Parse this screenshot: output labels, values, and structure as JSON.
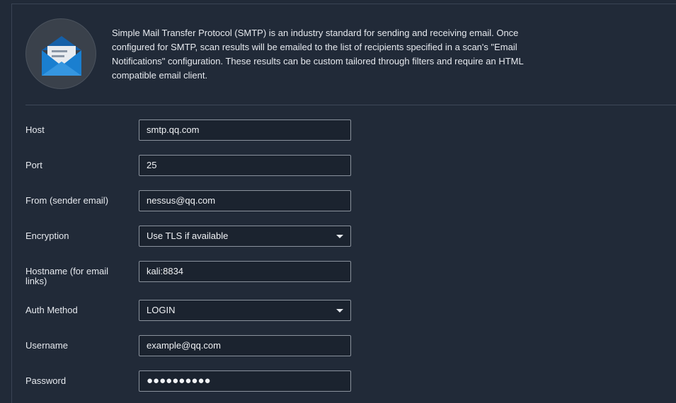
{
  "intro": {
    "icon": "email-envelope-icon",
    "description": "Simple Mail Transfer Protocol (SMTP) is an industry standard for sending and receiving email. Once configured for SMTP, scan results will be emailed to the list of recipients specified in a scan's \"Email Notifications\" configuration. These results can be custom tailored through filters and require an HTML compatible email client."
  },
  "form": {
    "host": {
      "label": "Host",
      "value": "smtp.qq.com"
    },
    "port": {
      "label": "Port",
      "value": "25"
    },
    "from": {
      "label": "From (sender email)",
      "value": "nessus@qq.com"
    },
    "encryption": {
      "label": "Encryption",
      "value": "Use TLS if available"
    },
    "hostname": {
      "label": "Hostname (for email links)",
      "value": "kali:8834"
    },
    "auth_method": {
      "label": "Auth Method",
      "value": "LOGIN"
    },
    "username": {
      "label": "Username",
      "value": "example@qq.com"
    },
    "password": {
      "label": "Password",
      "value": "●●●●●●●●●●"
    }
  },
  "colors": {
    "background": "#212a38",
    "input_border": "#8a929d",
    "icon_blue": "#1a7fd0"
  }
}
